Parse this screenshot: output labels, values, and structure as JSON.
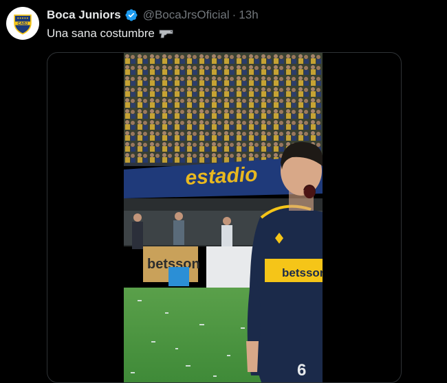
{
  "post": {
    "display_name": "Boca Juniors",
    "handle": "@BocaJrsOficial",
    "separator": "·",
    "time": "13h",
    "text": "Una sana costumbre",
    "avatar_text": "CABJ",
    "verified_icon": "verified-badge-icon",
    "text_emoji_icon": "water-pistol-icon"
  },
  "media": {
    "type": "video",
    "banner_text": "estadio",
    "sponsor_text": "betsson",
    "shirt_sponsor": "betsson",
    "jersey_number": "6"
  },
  "colors": {
    "background": "#000000",
    "text_primary": "#e7e9ea",
    "text_secondary": "#71767b",
    "verified": "#1d9bf0",
    "border": "#2f3336",
    "boca_blue": "#1b2a4a",
    "boca_gold": "#f5c518"
  }
}
